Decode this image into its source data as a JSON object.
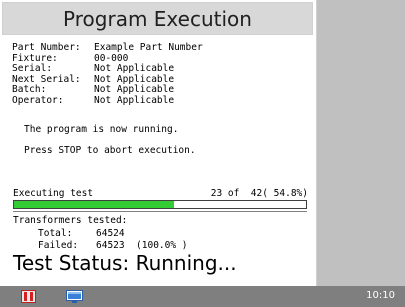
{
  "window": {
    "title": "Program Execution"
  },
  "info": [
    {
      "label": "Part Number:",
      "value": "Example Part Number"
    },
    {
      "label": "Fixture:",
      "value": "00-000"
    },
    {
      "label": "Serial:",
      "value": "Not Applicable"
    },
    {
      "label": "Next Serial:",
      "value": "Not Applicable"
    },
    {
      "label": "Batch:",
      "value": "Not Applicable"
    },
    {
      "label": "Operator:",
      "value": "Not Applicable"
    }
  ],
  "messages": {
    "running": "The program is now running.",
    "stop_hint": "Press STOP to abort execution."
  },
  "progress": {
    "label": "Executing test",
    "count_text": "23 of  42( 54.8%)",
    "fraction": 0.548,
    "fill_color": "#33cc33"
  },
  "tested": {
    "heading": "Transformers tested:",
    "total_label": "Total:",
    "total_value": "64524",
    "failed_label": "Failed:",
    "failed_value": "64523  (100.0% )"
  },
  "status": {
    "text": "Test Status: Running..."
  },
  "taskbar": {
    "clock": "10:10",
    "icons": [
      "app-icon",
      "monitor-icon"
    ]
  }
}
